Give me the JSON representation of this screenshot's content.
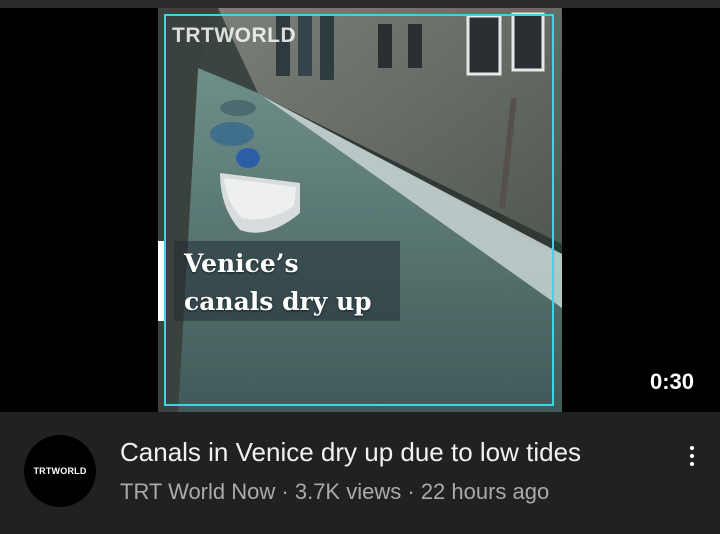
{
  "video": {
    "brand_logo": "TRTWORLD",
    "caption_line1": "Venice’s",
    "caption_line2": "canals dry up",
    "duration": "0:30"
  },
  "meta": {
    "channel_avatar_text": "TRTWORLD",
    "title": "Canals in Venice dry up due to low tides",
    "channel": "TRT World Now",
    "separator": "·",
    "views": "3.7K views",
    "age": "22 hours ago"
  },
  "colors": {
    "background": "#212121",
    "frame_border": "#3ad6e6",
    "title_text": "#f1f1f1",
    "secondary_text": "#aaaaaa"
  },
  "icons": {
    "menu": "more-vert-icon"
  }
}
